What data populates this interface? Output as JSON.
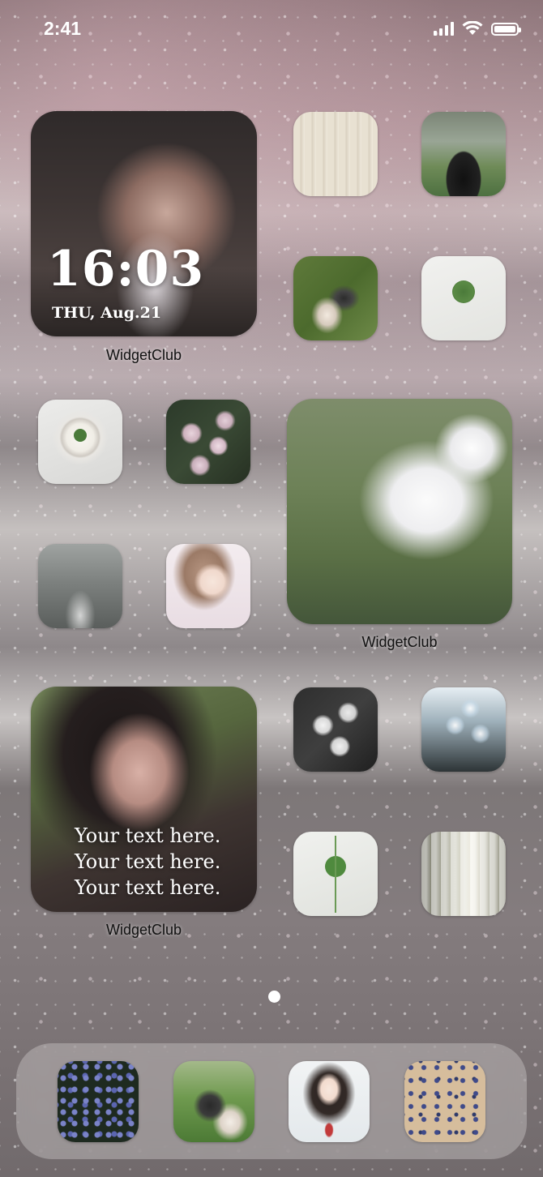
{
  "status_bar": {
    "time": "2:41",
    "icons": [
      "signal-icon",
      "wifi-icon",
      "battery-icon"
    ]
  },
  "widgets": {
    "clock": {
      "time": "16:03",
      "date": "THU, Aug.21",
      "label": "WidgetClub",
      "image": "girl-with-flowers-photo"
    },
    "cat": {
      "label": "WidgetClub",
      "image": "white-cat-on-grass-photo"
    },
    "text": {
      "lines": [
        "Your text here.",
        "Your text here.",
        "Your text here."
      ],
      "label": "WidgetClub",
      "image": "girl-portrait-photo"
    }
  },
  "apps": [
    {
      "name": "knit-texture"
    },
    {
      "name": "girl-with-camera"
    },
    {
      "name": "shoes-on-grass"
    },
    {
      "name": "clover-leaf"
    },
    {
      "name": "clover-latte"
    },
    {
      "name": "pink-roses"
    },
    {
      "name": "grey-sea"
    },
    {
      "name": "anime-girl-braid"
    },
    {
      "name": "white-roses"
    },
    {
      "name": "glass-wind-chimes"
    },
    {
      "name": "clover-plant"
    },
    {
      "name": "sheer-curtain"
    }
  ],
  "page_indicator": {
    "current": 1,
    "total": 1
  },
  "dock": [
    {
      "name": "blue-flowers"
    },
    {
      "name": "girl-in-grass"
    },
    {
      "name": "anime-girl-uniform"
    },
    {
      "name": "floral-pattern"
    }
  ]
}
